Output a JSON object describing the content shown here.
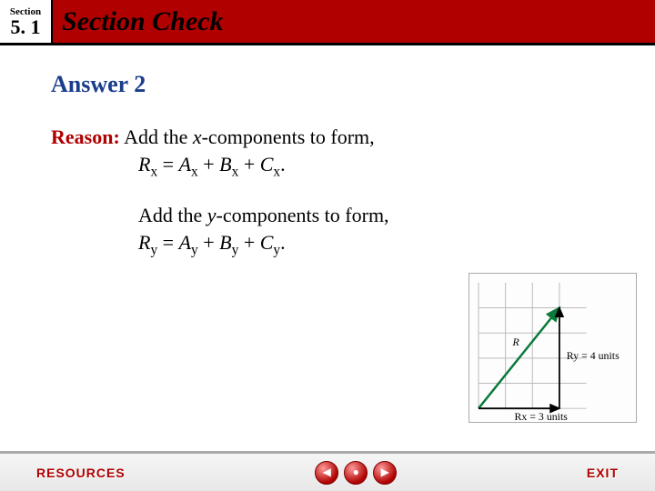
{
  "header": {
    "section_label": "Section",
    "section_number": "5. 1",
    "title": "Section Check"
  },
  "content": {
    "answer_heading": "Answer 2",
    "reason_label": "Reason:",
    "line1a": "Add the ",
    "line1b": "x",
    "line1c": "-components to form,",
    "eq1_lhs": "R",
    "eq1_lhs_sub": "x",
    "eq1_eq": " = ",
    "eq1_a": "A",
    "eq1_a_sub": "x",
    "eq1_p1": " + ",
    "eq1_b": "B",
    "eq1_b_sub": "x",
    "eq1_p2": " + ",
    "eq1_c": "C",
    "eq1_c_sub": "x",
    "eq1_end": ".",
    "line2a": "Add the ",
    "line2b": "y",
    "line2c": "-components to form,",
    "eq2_lhs": "R",
    "eq2_lhs_sub": "y",
    "eq2_eq": " = ",
    "eq2_a": "A",
    "eq2_a_sub": "y",
    "eq2_p1": " + ",
    "eq2_b": "B",
    "eq2_b_sub": "y",
    "eq2_p2": " + ",
    "eq2_c": "C",
    "eq2_c_sub": "y",
    "eq2_end": "."
  },
  "diagram": {
    "r_label": "R",
    "ry_label": "Ry = 4 units",
    "rx_label": "Rx = 3 units"
  },
  "footer": {
    "resources": "RESOURCES",
    "exit": "EXIT",
    "prev_glyph": "◀",
    "home_glyph": "●",
    "next_glyph": "▶"
  }
}
